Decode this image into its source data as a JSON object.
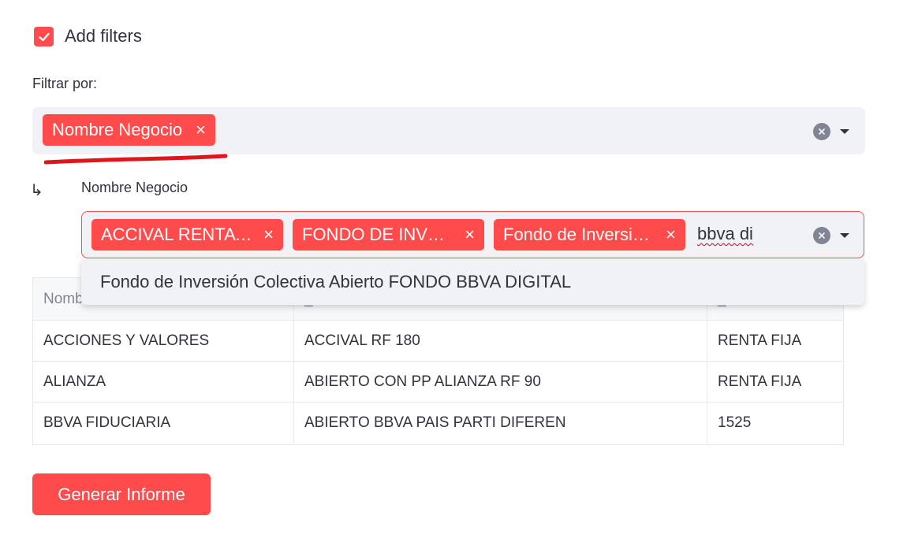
{
  "add_filters": {
    "label": "Add filters",
    "checked": true
  },
  "filter_by": {
    "label": "Filtrar por:"
  },
  "filter_select": {
    "tags": [
      {
        "label": "Nombre Negocio",
        "remove": "×"
      }
    ]
  },
  "sub_filter": {
    "arrow": "↳",
    "label": "Nombre Negocio",
    "tags": [
      {
        "label": "ACCIVAL RENTA …",
        "remove": "×"
      },
      {
        "label": "FONDO DE INVE…",
        "remove": "×"
      },
      {
        "label": "Fondo de Inversi…",
        "remove": "×"
      }
    ],
    "typed_value": "bbva di"
  },
  "dropdown": {
    "options": [
      "Fondo de Inversión Colectiva Abierto FONDO BBVA DIGITAL"
    ]
  },
  "table": {
    "header_visible": [
      "Nomb",
      "_",
      "_"
    ],
    "rows": [
      [
        "ACCIONES Y VALORES",
        "ACCIVAL RF 180",
        "RENTA FIJA"
      ],
      [
        "ALIANZA",
        "ABIERTO CON PP ALIANZA RF 90",
        "RENTA FIJA"
      ],
      [
        "BBVA FIDUCIARIA",
        "ABIERTO BBVA PAIS PARTI DIFEREN",
        "1525"
      ]
    ]
  },
  "generate_button": {
    "label": "Generar Informe"
  },
  "colors": {
    "accent": "#ff4b4b",
    "input_bg": "#f0f2f6",
    "text": "#31333f",
    "muted": "#808495"
  }
}
